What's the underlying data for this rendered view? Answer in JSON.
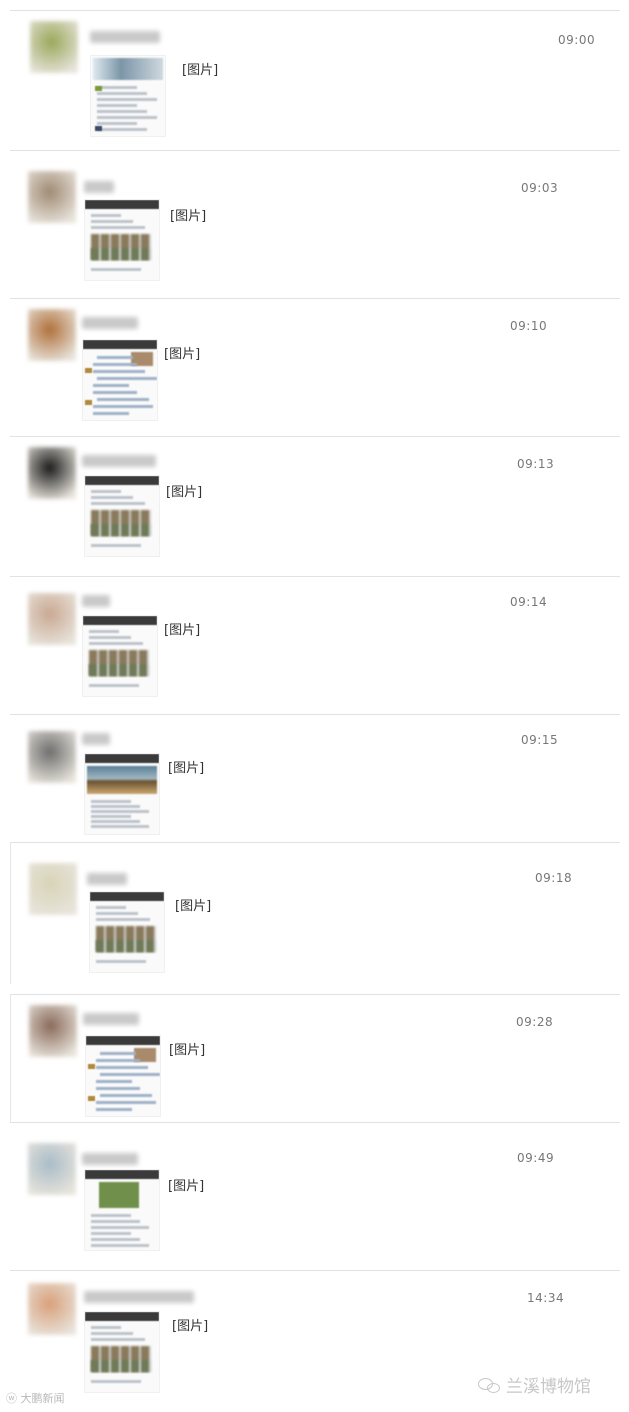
{
  "chat_rows": [
    {
      "time": "09:00",
      "tag": "[图片]",
      "avatar_color": "#9aa85a",
      "thumb_style": "banner"
    },
    {
      "time": "09:03",
      "tag": "[图片]",
      "avatar_color": "#a08a73",
      "thumb_style": "grid"
    },
    {
      "time": "09:10",
      "tag": "[图片]",
      "avatar_color": "#b0703a",
      "thumb_style": "feed"
    },
    {
      "time": "09:13",
      "tag": "[图片]",
      "avatar_color": "#1b1b1b",
      "thumb_style": "grid"
    },
    {
      "time": "09:14",
      "tag": "[图片]",
      "avatar_color": "#c9a892",
      "thumb_style": "grid"
    },
    {
      "time": "09:15",
      "tag": "[图片]",
      "avatar_color": "#6e6e6e",
      "thumb_style": "photo"
    },
    {
      "time": "09:18",
      "tag": "[图片]",
      "avatar_color": "#d8d4b8",
      "thumb_style": "grid"
    },
    {
      "time": "09:28",
      "tag": "[图片]",
      "avatar_color": "#8a6a5a",
      "thumb_style": "feed"
    },
    {
      "time": "09:49",
      "tag": "[图片]",
      "avatar_color": "#a9bcc8",
      "thumb_style": "photo2"
    },
    {
      "time": "14:34",
      "tag": "[图片]",
      "avatar_color": "#d9a07a",
      "thumb_style": "grid"
    }
  ],
  "footer": {
    "left_watermark": "大鹏新闻",
    "right_watermark": "兰溪博物馆",
    "right_icon": "wechat-icon"
  }
}
